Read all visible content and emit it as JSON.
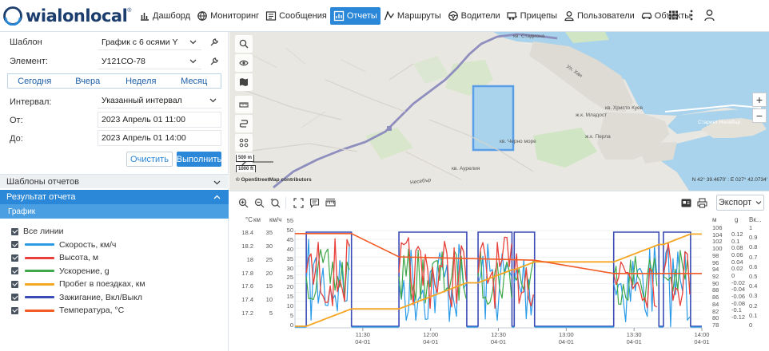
{
  "app": {
    "logo_text": "wialonlocal",
    "logo_mark": "®"
  },
  "nav": [
    {
      "id": "dashboard",
      "label": "Дашборд",
      "icon": "bar-chart-icon",
      "active": false
    },
    {
      "id": "monitoring",
      "label": "Мониторинг",
      "icon": "globe-icon",
      "active": false
    },
    {
      "id": "messages",
      "label": "Сообщения",
      "icon": "list-icon",
      "active": false
    },
    {
      "id": "reports",
      "label": "Отчеты",
      "icon": "report-icon",
      "active": true
    },
    {
      "id": "routes",
      "label": "Маршруты",
      "icon": "route-icon",
      "active": false
    },
    {
      "id": "drivers",
      "label": "Водители",
      "icon": "steering-wheel-icon",
      "active": false
    },
    {
      "id": "trailers",
      "label": "Прицепы",
      "icon": "trailer-icon",
      "active": false
    },
    {
      "id": "users",
      "label": "Пользователи",
      "icon": "user-icon",
      "active": false
    },
    {
      "id": "units",
      "label": "Объекты",
      "icon": "car-icon",
      "active": false
    }
  ],
  "report_form": {
    "template_label": "Шаблон",
    "template_value": "График с 6 осями Y",
    "element_label": "Элемент:",
    "element_value": "У121СО-78",
    "periods": [
      "Сегодня",
      "Вчера",
      "Неделя",
      "Месяц"
    ],
    "interval_label": "Интервал:",
    "interval_value": "Указанный интервал",
    "from_label": "От:",
    "from_value": "2023 Апрель 01 11:00",
    "to_label": "До:",
    "to_value": "2023 Апрель 01 14:00",
    "clear_label": "Очистить",
    "run_label": "Выполнить"
  },
  "sections": {
    "templates": "Шаблоны отчетов",
    "result": "Результат отчета",
    "chart": "График"
  },
  "legend": {
    "all_label": "Все линии",
    "items": [
      {
        "label": "Скорость, км/ч",
        "color": "#2b9be8"
      },
      {
        "label": "Высота, м",
        "color": "#e8403a"
      },
      {
        "label": "Ускорение, g",
        "color": "#3fa84a"
      },
      {
        "label": "Пробег в поездках, км",
        "color": "#f5a623"
      },
      {
        "label": "Зажигание, Вкл/Выкл",
        "color": "#3a4bb5"
      },
      {
        "label": "Температура, °С",
        "color": "#f25c27"
      }
    ]
  },
  "map": {
    "labels": [
      "кв. Стадиона",
      "кв. Христо Куев",
      "ж.к. Младост",
      "ж.к. Перла",
      "Старият Несебър",
      "кв. Черно море",
      "кв. Аурелия",
      "Несебър",
      "Ул. Хан"
    ],
    "scale_m": "500 m",
    "scale_ft": "1000 ft",
    "attribution": "© OpenStreetMap contributors",
    "coords": "N 42° 39.4670' : E 027° 42.0734'",
    "zoom_in": "+",
    "zoom_out": "−"
  },
  "chart_toolbar": {
    "export_label": "Экспорт"
  },
  "chart_data": {
    "type": "line",
    "left_axes": [
      {
        "unit": "°C",
        "ticks": [
          "18.4",
          "18.2",
          "18",
          "17.8",
          "17.6",
          "17.4",
          "17.2"
        ]
      },
      {
        "unit": "км",
        "ticks": [
          "35",
          "30",
          "25",
          "20",
          "15",
          "10",
          "5"
        ]
      },
      {
        "unit": "км/ч",
        "ticks": [
          "55",
          "50",
          "45",
          "40",
          "35",
          "30",
          "25",
          "20",
          "15",
          "10",
          "5",
          "0"
        ]
      }
    ],
    "right_axes": [
      {
        "unit": "м",
        "ticks": [
          "106",
          "104",
          "102",
          "100",
          "98",
          "96",
          "94",
          "92",
          "90",
          "88",
          "86",
          "84",
          "82",
          "80",
          "78"
        ]
      },
      {
        "unit": "g",
        "ticks": [
          "0.12",
          "0.1",
          "0.08",
          "0.06",
          "0.04",
          "0.02",
          "0",
          "-0.02",
          "-0.04",
          "-0.06",
          "-0.08",
          "-0.1",
          "-0.12"
        ]
      },
      {
        "unit": "Вк...",
        "ticks": [
          "1",
          "0.9",
          "0.8",
          "0.7",
          "0.6",
          "0.5",
          "0.4",
          "0.3",
          "0.2",
          "0.1",
          "0"
        ]
      }
    ],
    "x_ticks": [
      {
        "time": "11:30",
        "date": "04-01"
      },
      {
        "time": "12:00",
        "date": "04-01"
      },
      {
        "time": "12:30",
        "date": "04-01"
      },
      {
        "time": "13:00",
        "date": "04-01"
      },
      {
        "time": "13:30",
        "date": "04-01"
      },
      {
        "time": "14:00",
        "date": "04-01"
      }
    ],
    "x_range": [
      "11:00",
      "14:00"
    ],
    "ignition_on": [
      [
        "11:05",
        "11:25"
      ],
      [
        "11:46",
        "12:16"
      ],
      [
        "12:21",
        "12:36"
      ],
      [
        "12:37",
        "12:46"
      ],
      [
        "13:21",
        "13:41"
      ],
      [
        "13:43",
        "13:55"
      ]
    ],
    "mileage_km": {
      "start": 0,
      "end": 34
    },
    "temperature_c": [
      18.45,
      18.1,
      18.05,
      17.85
    ]
  }
}
